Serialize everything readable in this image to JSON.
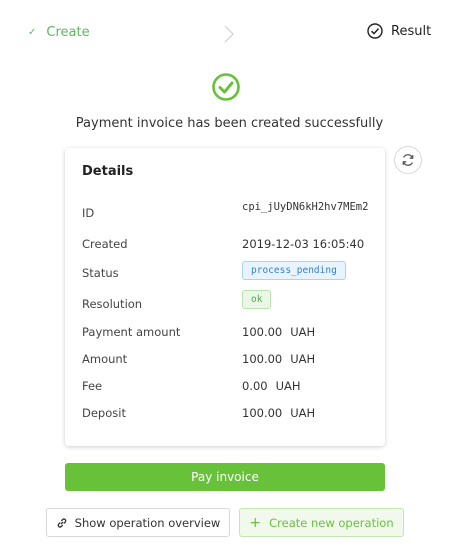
{
  "steps": {
    "create_label": "Create",
    "result_label": "Result"
  },
  "success_message": "Payment invoice has been created successfully",
  "details": {
    "title": "Details",
    "rows": [
      {
        "label": "ID",
        "value": "cpi_jUyDN6kH2hv7MEm2"
      },
      {
        "label": "Created",
        "value": "2019-12-03 16:05:40"
      },
      {
        "label": "Status",
        "value": "process_pending"
      },
      {
        "label": "Resolution",
        "value": "ok"
      },
      {
        "label": "Payment amount",
        "value": "100.00",
        "currency": "UAH"
      },
      {
        "label": "Amount",
        "value": "100.00",
        "currency": "UAH"
      },
      {
        "label": "Fee",
        "value": "0.00",
        "currency": "UAH"
      },
      {
        "label": "Deposit",
        "value": "100.00",
        "currency": "UAH"
      }
    ]
  },
  "buttons": {
    "pay": "Pay invoice",
    "overview": "Show operation overview",
    "create_new": "Create new operation"
  },
  "colors": {
    "success": "#67c23a",
    "status_tag": "#3b7fc4",
    "resolution_tag": "#4caf50"
  },
  "icons": {
    "refresh": "refresh-icon",
    "link": "link-icon",
    "success": "check-circle-icon"
  }
}
